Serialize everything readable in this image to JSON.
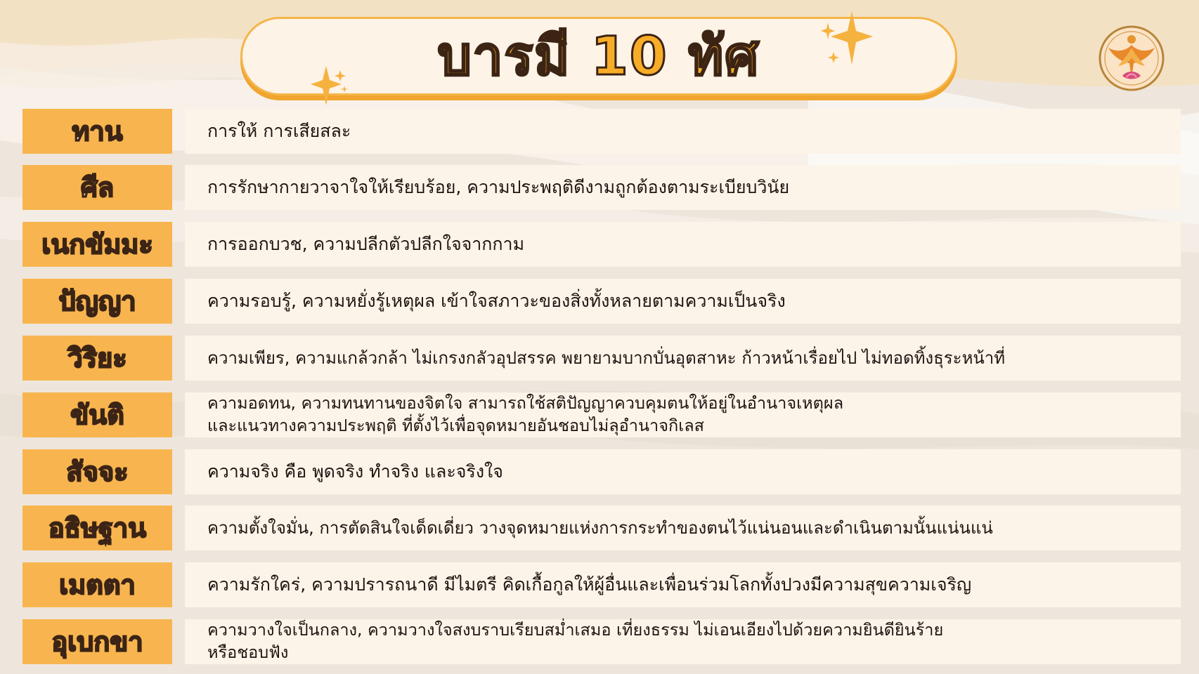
{
  "title": "บารมี 10 ทัศ",
  "colors": {
    "label_fill": "#f8b54f",
    "description_fill": "#fdf4e9",
    "title_fill": "#f8ad28",
    "outline": "#3c2414",
    "background": "#efe7dc"
  },
  "icons": {
    "sparkle": "four-point-star",
    "logo": "garuda-emblem-logo"
  },
  "items": [
    {
      "label": "ทาน",
      "description": "การให้ การเสียสละ"
    },
    {
      "label": "ศีล",
      "description": "การรักษากายวาจาใจให้เรียบร้อย, ความประพฤติดีงามถูกต้องตามระเบียบวินัย"
    },
    {
      "label": "เนกขัมมะ",
      "description": "การออกบวช, ความปลีกตัวปลีกใจจากกาม"
    },
    {
      "label": "ปัญญา",
      "description": "ความรอบรู้, ความหยั่งรู้เหตุผล เข้าใจสภาวะของสิ่งทั้งหลายตามความเป็นจริง"
    },
    {
      "label": "วิริยะ",
      "description": "ความเพียร, ความแกล้วกล้า ไม่เกรงกลัวอุปสรรค พยายามบากบั่นอุตสาหะ ก้าวหน้าเรื่อยไป ไม่ทอดทิ้งธุระหน้าที่"
    },
    {
      "label": "ขันติ",
      "description": "ความอดทน, ความทนทานของจิตใจ สามารถใช้สติปัญญาควบคุมตนให้อยู่ในอำนาจเหตุผล\nและแนวทางความประพฤติ ที่ตั้งไว้เพื่อจุดหมายอันชอบไม่ลุอำนาจกิเลส"
    },
    {
      "label": "สัจจะ",
      "description": "ความจริง คือ พูดจริง ทำจริง และจริงใจ"
    },
    {
      "label": "อธิษฐาน",
      "description": "ความตั้งใจมั่น, การตัดสินใจเด็ดเดี่ยว วางจุดหมายแห่งการกระทำของตนไว้แน่นอนและดำเนินตามนั้นแน่นแน่"
    },
    {
      "label": "เมตตา",
      "description": "ความรักใคร่, ความปรารถนาดี มีไมตรี คิดเกื้อกูลให้ผู้อื่นและเพื่อนร่วมโลกทั้งปวงมีความสุขความเจริญ"
    },
    {
      "label": "อุเบกขา",
      "description": "ความวางใจเป็นกลาง, ความวางใจสงบราบเรียบสม่ำเสมอ เที่ยงธรรม ไม่เอนเอียงไปด้วยความยินดียินร้าย\nหรือชอบฟัง"
    }
  ]
}
